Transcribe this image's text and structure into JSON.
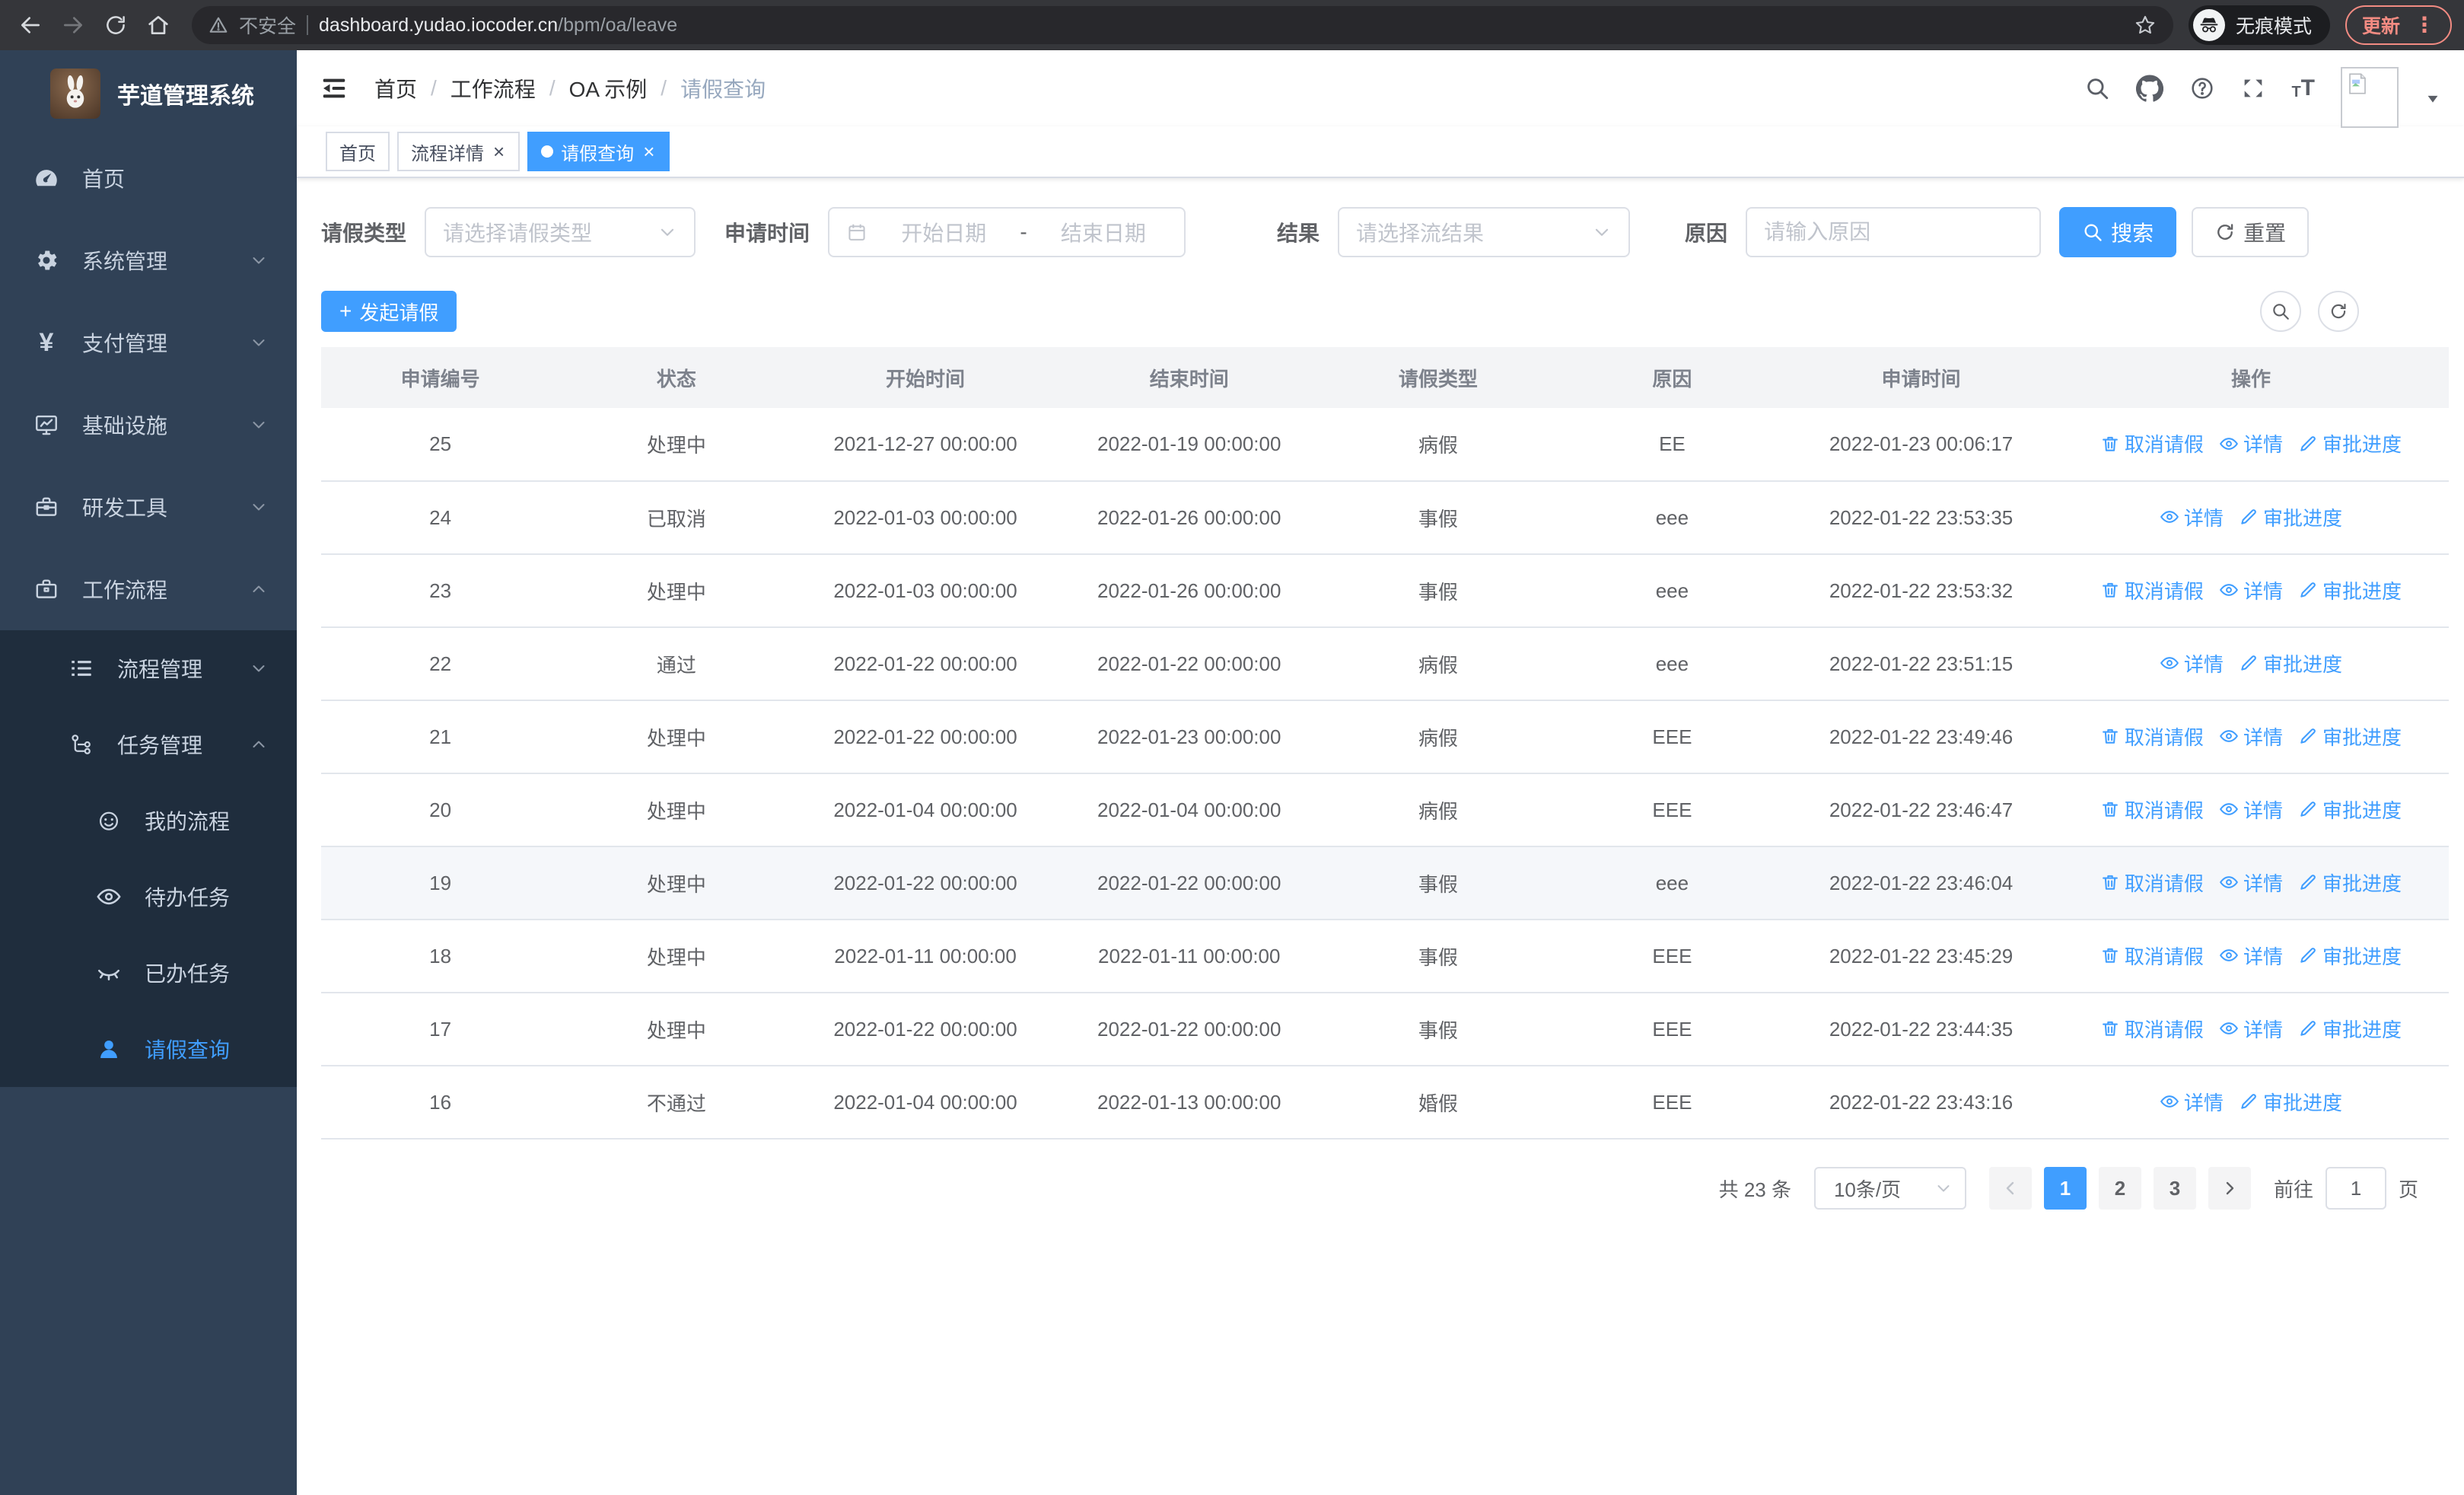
{
  "browser": {
    "security_label": "不安全",
    "url_host": "dashboard.yudao.iocoder.cn",
    "url_path": "/bpm/oa/leave",
    "incognito_label": "无痕模式",
    "update_label": "更新",
    "menu_dots": "⋮"
  },
  "sidebar": {
    "logo_title": "芋道管理系统",
    "menu": [
      {
        "key": "home",
        "label": "首页",
        "icon": "dashboard-icon",
        "level": 1,
        "sub": false,
        "chevron": null,
        "active": false
      },
      {
        "key": "system",
        "label": "系统管理",
        "icon": "gear-icon",
        "level": 1,
        "sub": false,
        "chevron": "down",
        "active": false
      },
      {
        "key": "payment",
        "label": "支付管理",
        "icon": "yen-icon",
        "level": 1,
        "sub": false,
        "chevron": "down",
        "active": false
      },
      {
        "key": "infra",
        "label": "基础设施",
        "icon": "monitor-icon",
        "level": 1,
        "sub": false,
        "chevron": "down",
        "active": false
      },
      {
        "key": "devtools",
        "label": "研发工具",
        "icon": "toolbox-icon",
        "level": 1,
        "sub": false,
        "chevron": "down",
        "active": false
      },
      {
        "key": "workflow",
        "label": "工作流程",
        "icon": "briefcase-icon",
        "level": 1,
        "sub": false,
        "chevron": "up",
        "active": false
      },
      {
        "key": "process-mgmt",
        "label": "流程管理",
        "icon": "list-icon",
        "level": 2,
        "sub": true,
        "chevron": "down",
        "active": false
      },
      {
        "key": "task-mgmt",
        "label": "任务管理",
        "icon": "tree-icon",
        "level": 2,
        "sub": true,
        "chevron": "up",
        "active": false
      },
      {
        "key": "my-process",
        "label": "我的流程",
        "icon": "robot-icon",
        "level": 3,
        "sub": true,
        "chevron": null,
        "active": false
      },
      {
        "key": "todo-tasks",
        "label": "待办任务",
        "icon": "eye-open-icon",
        "level": 3,
        "sub": true,
        "chevron": null,
        "active": false
      },
      {
        "key": "done-tasks",
        "label": "已办任务",
        "icon": "eye-closed-icon",
        "level": 3,
        "sub": true,
        "chevron": null,
        "active": false
      },
      {
        "key": "leave-query",
        "label": "请假查询",
        "icon": "user-icon",
        "level": 3,
        "sub": true,
        "chevron": null,
        "active": true
      }
    ]
  },
  "header": {
    "breadcrumb": [
      "首页",
      "工作流程",
      "OA 示例",
      "请假查询"
    ]
  },
  "tags": [
    {
      "key": "home",
      "label": "首页",
      "closable": false,
      "active": false
    },
    {
      "key": "process-detail",
      "label": "流程详情",
      "closable": true,
      "active": false
    },
    {
      "key": "leave-query",
      "label": "请假查询",
      "closable": true,
      "active": true
    }
  ],
  "filters": {
    "leave_type_label": "请假类型",
    "leave_type_placeholder": "请选择请假类型",
    "apply_time_label": "申请时间",
    "date_start_placeholder": "开始日期",
    "date_separator": "-",
    "date_end_placeholder": "结束日期",
    "result_label": "结果",
    "result_placeholder": "请选择流结果",
    "reason_label": "原因",
    "reason_placeholder": "请输入原因",
    "search_label": "搜索",
    "reset_label": "重置"
  },
  "toolbar": {
    "create_label": "发起请假"
  },
  "table": {
    "columns": [
      "申请编号",
      "状态",
      "开始时间",
      "结束时间",
      "请假类型",
      "原因",
      "申请时间",
      "操作"
    ],
    "action_labels": {
      "cancel": "取消请假",
      "detail": "详情",
      "progress": "审批进度"
    },
    "rows": [
      {
        "id": "25",
        "status": "处理中",
        "start": "2021-12-27 00:00:00",
        "end": "2022-01-19 00:00:00",
        "type": "病假",
        "reason": "EE",
        "apply_time": "2022-01-23 00:06:17",
        "actions": [
          "cancel",
          "detail",
          "progress"
        ],
        "highlight": false
      },
      {
        "id": "24",
        "status": "已取消",
        "start": "2022-01-03 00:00:00",
        "end": "2022-01-26 00:00:00",
        "type": "事假",
        "reason": "eee",
        "apply_time": "2022-01-22 23:53:35",
        "actions": [
          "detail",
          "progress"
        ],
        "highlight": false
      },
      {
        "id": "23",
        "status": "处理中",
        "start": "2022-01-03 00:00:00",
        "end": "2022-01-26 00:00:00",
        "type": "事假",
        "reason": "eee",
        "apply_time": "2022-01-22 23:53:32",
        "actions": [
          "cancel",
          "detail",
          "progress"
        ],
        "highlight": false
      },
      {
        "id": "22",
        "status": "通过",
        "start": "2022-01-22 00:00:00",
        "end": "2022-01-22 00:00:00",
        "type": "病假",
        "reason": "eee",
        "apply_time": "2022-01-22 23:51:15",
        "actions": [
          "detail",
          "progress"
        ],
        "highlight": false
      },
      {
        "id": "21",
        "status": "处理中",
        "start": "2022-01-22 00:00:00",
        "end": "2022-01-23 00:00:00",
        "type": "病假",
        "reason": "EEE",
        "apply_time": "2022-01-22 23:49:46",
        "actions": [
          "cancel",
          "detail",
          "progress"
        ],
        "highlight": false
      },
      {
        "id": "20",
        "status": "处理中",
        "start": "2022-01-04 00:00:00",
        "end": "2022-01-04 00:00:00",
        "type": "病假",
        "reason": "EEE",
        "apply_time": "2022-01-22 23:46:47",
        "actions": [
          "cancel",
          "detail",
          "progress"
        ],
        "highlight": false
      },
      {
        "id": "19",
        "status": "处理中",
        "start": "2022-01-22 00:00:00",
        "end": "2022-01-22 00:00:00",
        "type": "事假",
        "reason": "eee",
        "apply_time": "2022-01-22 23:46:04",
        "actions": [
          "cancel",
          "detail",
          "progress"
        ],
        "highlight": true
      },
      {
        "id": "18",
        "status": "处理中",
        "start": "2022-01-11 00:00:00",
        "end": "2022-01-11 00:00:00",
        "type": "事假",
        "reason": "EEE",
        "apply_time": "2022-01-22 23:45:29",
        "actions": [
          "cancel",
          "detail",
          "progress"
        ],
        "highlight": false
      },
      {
        "id": "17",
        "status": "处理中",
        "start": "2022-01-22 00:00:00",
        "end": "2022-01-22 00:00:00",
        "type": "事假",
        "reason": "EEE",
        "apply_time": "2022-01-22 23:44:35",
        "actions": [
          "cancel",
          "detail",
          "progress"
        ],
        "highlight": false
      },
      {
        "id": "16",
        "status": "不通过",
        "start": "2022-01-04 00:00:00",
        "end": "2022-01-13 00:00:00",
        "type": "婚假",
        "reason": "EEE",
        "apply_time": "2022-01-22 23:43:16",
        "actions": [
          "detail",
          "progress"
        ],
        "highlight": false
      }
    ]
  },
  "pagination": {
    "total_text": "共 23 条",
    "page_size": "10条/页",
    "pages": [
      "1",
      "2",
      "3"
    ],
    "active_page": "1",
    "goto_label": "前往",
    "goto_value": "1",
    "goto_suffix": "页"
  },
  "colors": {
    "primary": "#409EFF",
    "sidebar_bg": "#304156",
    "submenu_bg": "#1f2d3d",
    "update_accent": "#f28b82"
  }
}
